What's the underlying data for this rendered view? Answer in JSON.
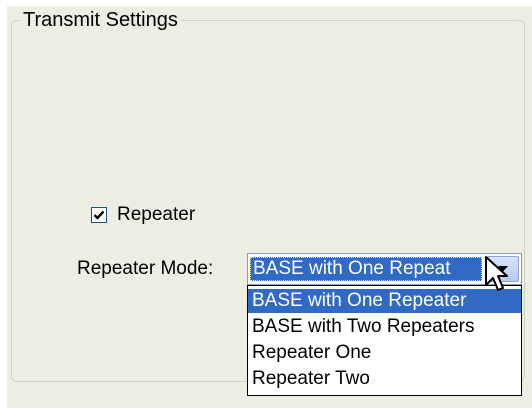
{
  "groupbox": {
    "title": "Transmit Settings"
  },
  "repeater_checkbox": {
    "label": "Repeater",
    "checked": true
  },
  "repeater_mode": {
    "label": "Repeater Mode:",
    "selected_value": "BASE with One Repeat",
    "options": [
      "BASE with One Repeater",
      "BASE with Two Repeaters",
      "Repeater One",
      "Repeater Two"
    ],
    "highlighted_option": "BASE with One Repeater"
  },
  "icons": {
    "checkbox_check": "checkmark-icon",
    "dropdown_arrow": "chevron-down-icon",
    "mouse_cursor": "mouse-pointer-icon"
  },
  "colors": {
    "panel_bg": "#eeede4",
    "selection_bg": "#316ac5",
    "selection_fg": "#ffffff"
  }
}
